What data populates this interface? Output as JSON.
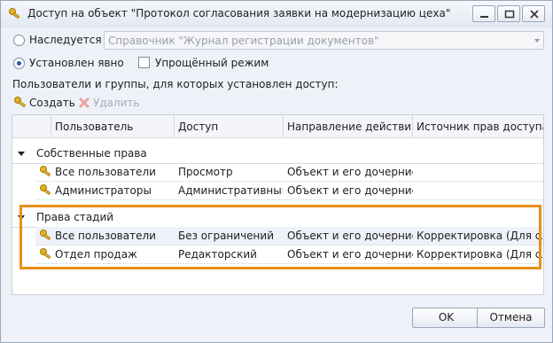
{
  "window": {
    "title": "Доступ на объект \"Протокол согласования заявки на модернизацию цеха\""
  },
  "inherits": {
    "label": "Наследуется с:",
    "combo_value": "Справочник \"Журнал регистрации документов\""
  },
  "explicit": {
    "label": "Установлен явно"
  },
  "simplified": {
    "label": "Упрощённый режим"
  },
  "section_label": "Пользователи и группы, для которых установлен доступ:",
  "toolbar": {
    "create_label": "Создать",
    "delete_label": "Удалить"
  },
  "grid": {
    "columns": [
      "Пользователь",
      "Доступ",
      "Направление действия",
      "Источник прав доступа"
    ],
    "groups": [
      {
        "label": "Собственные права",
        "rows": [
          {
            "user": "Все пользователи",
            "access": "Просмотр",
            "direction": "Объект и его дочерние...",
            "source": ""
          },
          {
            "user": "Администраторы",
            "access": "Административный",
            "direction": "Объект и его дочерние...",
            "source": ""
          }
        ]
      },
      {
        "label": "Права стадий",
        "rows": [
          {
            "user": "Все пользователи",
            "access": "Без ограничений",
            "direction": "Объект и его дочерние...",
            "source": "Корректировка (Для сл..."
          },
          {
            "user": "Отдел продаж",
            "access": "Редакторский",
            "direction": "Объект и его дочерние...",
            "source": "Корректировка (Для сл..."
          }
        ]
      }
    ]
  },
  "buttons": {
    "ok": "OK",
    "cancel": "Отмена"
  },
  "colors": {
    "highlight": "#e8901a",
    "key_icon": "#e0b020"
  }
}
